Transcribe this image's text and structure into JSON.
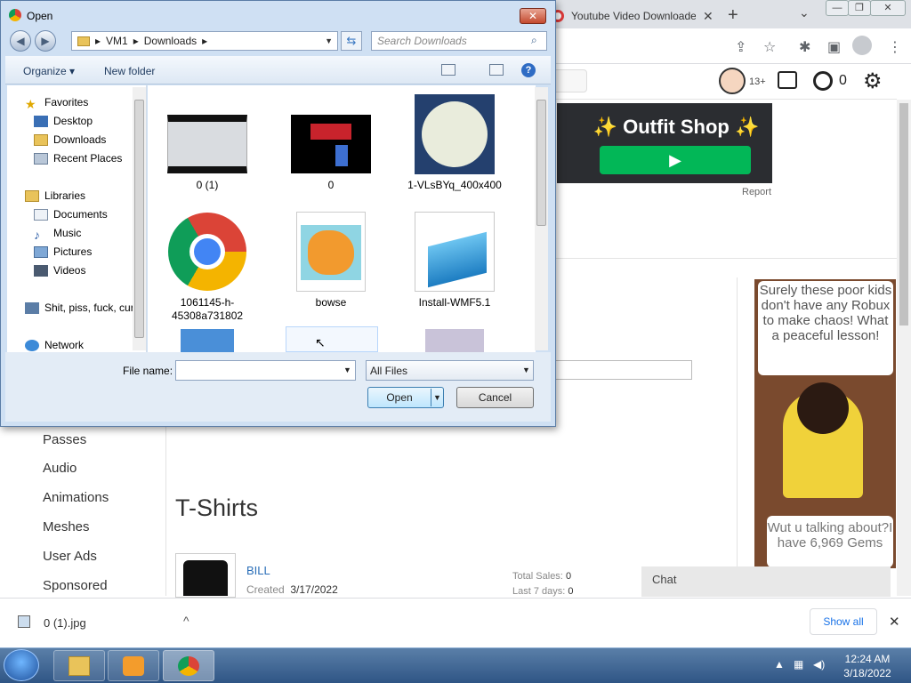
{
  "browser": {
    "tab_title": "Youtube Video Downloader",
    "tab_close": "✕",
    "new_tab": "+",
    "tab_search": "⌄",
    "win_min": "—",
    "win_max": "❐",
    "win_close": "✕"
  },
  "roblox": {
    "age_badge": "13+",
    "robux_count": "0",
    "ad_banner_title": "✨ Outfit Shop ✨",
    "ad_banner_play": "▶",
    "report": "Report",
    "sidenav": [
      "Passes",
      "Audio",
      "Animations",
      "Meshes",
      "User Ads",
      "Sponsored"
    ],
    "section_title": "T-Shirts",
    "item": {
      "name": "BILL",
      "created_label": "Created",
      "created_date": "3/17/2022",
      "total_sales_label": "Total Sales:",
      "total_sales": "0",
      "last7_label": "Last 7 days:",
      "last7": "0"
    },
    "side_ad_text": "Surely these poor kids don't have any Robux to make chaos! What a peaceful lesson!",
    "side_ad_text2": "Wut u talking about?I have 6,969 Gems",
    "chat": "Chat"
  },
  "downloads_bar": {
    "file": "0 (1).jpg",
    "show_all": "Show all",
    "close": "✕",
    "caret": "^"
  },
  "dialog": {
    "title": "Open",
    "close": "✕",
    "breadcrumb": [
      "VM1",
      "Downloads"
    ],
    "search_placeholder": "Search Downloads",
    "organize": "Organize ▾",
    "new_folder": "New folder",
    "help": "?",
    "nav": {
      "favorites": "Favorites",
      "desktop": "Desktop",
      "downloads": "Downloads",
      "recent": "Recent Places",
      "libraries": "Libraries",
      "documents": "Documents",
      "music": "Music",
      "pictures": "Pictures",
      "videos": "Videos",
      "computer": "Shit, piss, fuck, cur",
      "network": "Network"
    },
    "files": [
      {
        "label": "0 (1)"
      },
      {
        "label": "0"
      },
      {
        "label": "1-VLsBYq_400x400"
      },
      {
        "label": "1061145-h-45308a731802"
      },
      {
        "label": "bowse"
      },
      {
        "label": "Install-WMF5.1"
      }
    ],
    "file_name_label": "File name:",
    "file_name_value": "",
    "file_type": "All Files",
    "open_button": "Open",
    "cancel_button": "Cancel"
  },
  "taskbar": {
    "time": "12:24 AM",
    "date": "3/18/2022"
  }
}
